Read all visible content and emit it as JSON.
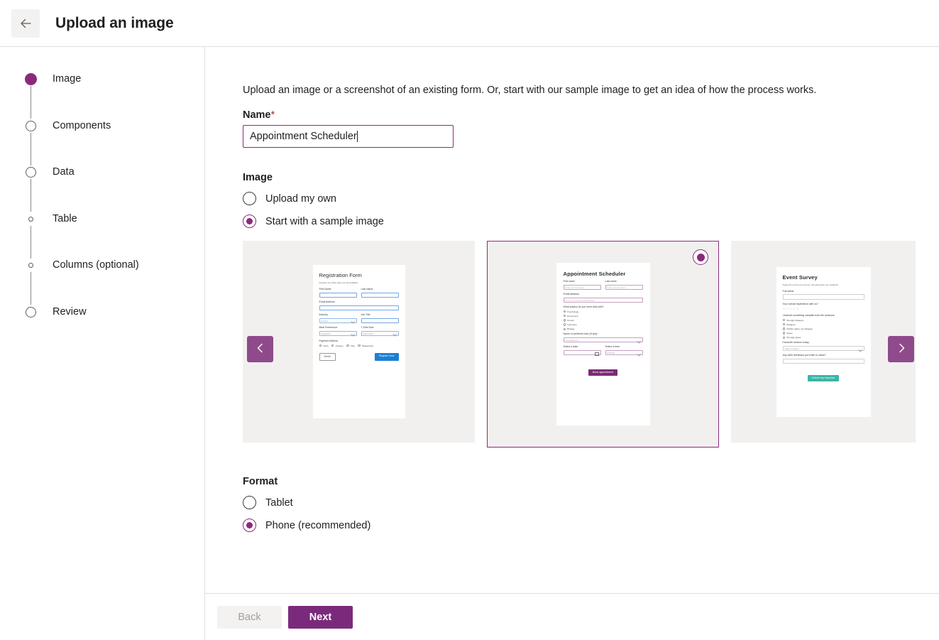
{
  "header": {
    "back_icon": "arrow-left-icon",
    "title": "Upload an image"
  },
  "sidebar": {
    "steps": [
      {
        "label": "Image",
        "state": "active"
      },
      {
        "label": "Components",
        "state": "pending"
      },
      {
        "label": "Data",
        "state": "pending"
      },
      {
        "label": "Table",
        "state": "sub"
      },
      {
        "label": "Columns (optional)",
        "state": "sub"
      },
      {
        "label": "Review",
        "state": "pending"
      }
    ]
  },
  "main": {
    "intro": "Upload an image or a screenshot of an existing form. Or, start with our sample image to get an idea of how the process works.",
    "name_label": "Name",
    "name_required_mark": "*",
    "name_value": "Appointment Scheduler",
    "image_section_title": "Image",
    "image_options": [
      {
        "label": "Upload my own",
        "selected": false
      },
      {
        "label": "Start with a sample image",
        "selected": true
      }
    ],
    "format_section_title": "Format",
    "format_options": [
      {
        "label": "Tablet",
        "selected": false
      },
      {
        "label": "Phone (recommended)",
        "selected": true
      }
    ],
    "carousel": {
      "prev_icon": "chevron-left-icon",
      "next_icon": "chevron-right-icon",
      "selected_index": 1
    }
  },
  "samples": {
    "registration": {
      "title": "Registration Form",
      "subtitle": "Register now while seats are still available!",
      "first_name_label": "First Name",
      "last_name_label": "Last Name",
      "email_label": "Email Address",
      "industry_label": "Industry",
      "industry_value": "Finance",
      "job_title_label": "Job Title",
      "meal_label": "Meal Preference",
      "meal_value": "Vegetarian",
      "tshirt_label": "T-Shirt Size",
      "tshirt_value": "Extra small",
      "payment_label": "Payment Method",
      "payment_options": [
        "Cash",
        "Cheque",
        "Visa",
        "Mastercard"
      ],
      "reset_button": "Reset",
      "submit_button": "Register Now"
    },
    "appointment": {
      "title": "Appointment Scheduler",
      "first_name_label": "First name",
      "first_name_placeholder": "Enter your first name",
      "last_name_label": "Last name",
      "last_name_placeholder": "Enter your last name",
      "email_label": "Email address:",
      "email_placeholder": "Enter your student email address",
      "subject_label": "What subject do you need help with?",
      "subject_options": [
        "Psychology",
        "Economics",
        "French",
        "Geometry",
        "Biology"
      ],
      "tutor_label": "Name of preferred tutor (if any)",
      "tutor_value": "No preference",
      "date_label": "Select a date:",
      "time_label": "Select a time:",
      "time_value": "9:00 AM",
      "submit_button": "Book appointment"
    },
    "survey": {
      "title": "Event Survey",
      "subtitle": "Please fill out the event survey. We appreciate your feedback.",
      "full_name_label": "Full Name",
      "experience_label": "Your overall experience with us?",
      "stars": "☆☆☆☆☆",
      "likert_label": "I learned something valuable from the sessions",
      "likert_options": [
        "Strongly disagree",
        "Disagree",
        "Neither agree nor disagree",
        "Agree",
        "Strongly agree"
      ],
      "session_label": "Favourite session today:",
      "session_value": "Select a session",
      "feedback_label": "Any other feedback you'd like to share?",
      "submit_button": "Submit my response"
    }
  },
  "footer": {
    "back_label": "Back",
    "next_label": "Next"
  },
  "colors": {
    "accent": "#8A2A7B",
    "next_button": "#7B2A7B",
    "arrow_button": "#8f4a8b",
    "registration_submit": "#1b7fd4",
    "appointment_submit": "#7b2a74",
    "survey_submit": "#3cb5a6"
  }
}
